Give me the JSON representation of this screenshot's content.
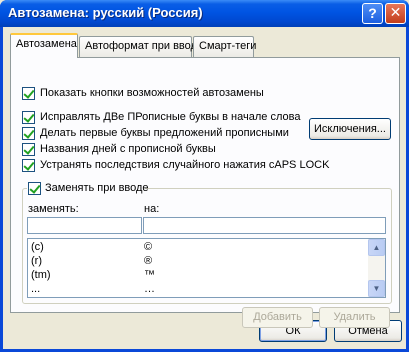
{
  "window": {
    "title": "Автозамена: русский (Россия)",
    "help_label": "?",
    "close_label": "✕"
  },
  "tabs": [
    {
      "label": "Автозамена",
      "active": true
    },
    {
      "label": "Автоформат при вводе",
      "active": false
    },
    {
      "label": "Смарт-теги",
      "active": false
    }
  ],
  "options": {
    "show_buttons": {
      "label": "Показать кнопки возможностей автозамены",
      "checked": true
    },
    "fix_two_caps": {
      "label": "Исправлять ДВе ПРописные буквы в начале слова",
      "checked": true
    },
    "cap_first_letter": {
      "label": "Делать первые буквы предложений прописными",
      "checked": true
    },
    "cap_day_names": {
      "label": "Названия дней с прописной буквы",
      "checked": true
    },
    "fix_caps_lock": {
      "label": "Устранять последствия случайного нажатия cAPS LOCK",
      "checked": true
    }
  },
  "exceptions_button": "Исключения...",
  "replace_group": {
    "label": "Заменять при вводе",
    "checked": true,
    "replace_label": "заменять:",
    "with_label": "на:",
    "replace_value": "",
    "with_value": ""
  },
  "replacements": [
    {
      "from": "(c)",
      "to": "©"
    },
    {
      "from": "(r)",
      "to": "®"
    },
    {
      "from": "(tm)",
      "to": "™"
    },
    {
      "from": "...",
      "to": "…"
    }
  ],
  "scroll": {
    "up": "▲",
    "down": "▼"
  },
  "buttons": {
    "add": "Добавить",
    "delete": "Удалить",
    "ok": "ОК",
    "cancel": "Отмена"
  }
}
